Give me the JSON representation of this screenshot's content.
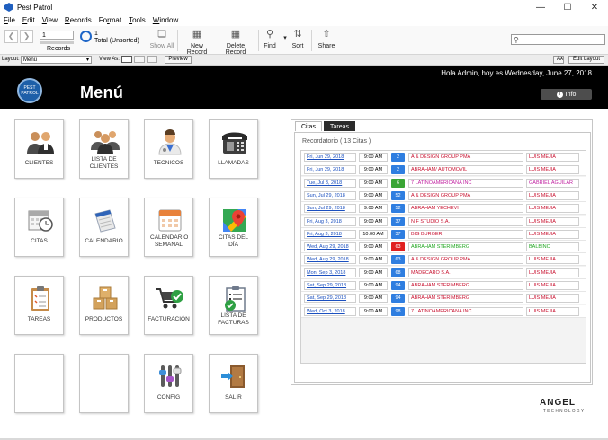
{
  "window": {
    "title": "Pest Patrol",
    "controls": [
      "—",
      "☐",
      "✕"
    ]
  },
  "menubar": [
    {
      "label": "File",
      "u": "F",
      "rest": "ile"
    },
    {
      "label": "Edit",
      "u": "E",
      "rest": "dit"
    },
    {
      "label": "View",
      "u": "V",
      "rest": "iew"
    },
    {
      "label": "Records",
      "u": "R",
      "rest": "ecords"
    },
    {
      "label": "Format",
      "pre": "Fo",
      "u": "r",
      "rest": "mat"
    },
    {
      "label": "Tools",
      "u": "T",
      "rest": "ools"
    },
    {
      "label": "Window",
      "u": "W",
      "rest": "indow"
    }
  ],
  "toolbar": {
    "record_value": "1",
    "records_label": "Records",
    "total_count": "1",
    "total_label": "Total (Unsorted)",
    "show_all": "Show All",
    "new_record": "New Record",
    "delete_record": "Delete Record",
    "find": "Find",
    "sort": "Sort",
    "share": "Share",
    "search_placeholder": ""
  },
  "layoutbar": {
    "layout_label": "Layout:",
    "layout_value": "Menú",
    "view_as_label": "View As:",
    "preview": "Preview",
    "aa": "Aᴀ",
    "edit_layout": "Edit Layout"
  },
  "header": {
    "logo_text": "PEST PATROL",
    "title": "Menú",
    "greeting": "Hola Admin, hoy es Wednesday, June 27, 2018",
    "info": "Info"
  },
  "tiles": [
    {
      "label": "CLIENTES",
      "icon": "clients-icon"
    },
    {
      "label": "LISTA DE CLIENTES",
      "icon": "client-list-icon"
    },
    {
      "label": "TECNICOS",
      "icon": "technician-icon"
    },
    {
      "label": "LLAMADAS",
      "icon": "phone-icon"
    },
    {
      "label": "CITAS",
      "icon": "calendar-clock-icon"
    },
    {
      "label": "CALENDARIO",
      "icon": "notepad-icon"
    },
    {
      "label": "CALENDARIO SEMANAL",
      "icon": "weekly-calendar-icon"
    },
    {
      "label": "CITAS DEL DÍA",
      "icon": "map-icon"
    },
    {
      "label": "TAREAS",
      "icon": "clipboard-icon"
    },
    {
      "label": "PRODUCTOS",
      "icon": "boxes-icon"
    },
    {
      "label": "FACTURACIÓN",
      "icon": "cart-check-icon"
    },
    {
      "label": "LISTA DE FACTURAS",
      "icon": "invoice-list-icon"
    },
    {
      "label": "",
      "icon": ""
    },
    {
      "label": "",
      "icon": ""
    },
    {
      "label": "CONFIG",
      "icon": "sliders-icon"
    },
    {
      "label": "SALIR",
      "icon": "exit-door-icon"
    }
  ],
  "tabs": [
    {
      "label": "Citas",
      "active": true
    },
    {
      "label": "Tareas",
      "active": false
    }
  ],
  "appointments_title": "Recordatorio  ( 13  Citas )",
  "appointments": [
    {
      "date": "Fri, Jun 29, 2018",
      "time": "9:00 AM",
      "num": "2",
      "badge_color": "#2f7ee0",
      "client": "A & DESIGN GROUP PMA",
      "client_color": "#c8102e",
      "person": "LUIS MEJIA",
      "person_color": "#c8102e"
    },
    {
      "date": "Fri, Jun 29, 2018",
      "time": "9:00 AM",
      "num": "2",
      "badge_color": "#2f7ee0",
      "client": "ABRAHAM/ AUTOMOVIL",
      "client_color": "#c8102e",
      "person": "LUIS MEJIA",
      "person_color": "#c8102e"
    },
    {
      "date": "Tue, Jul 3, 2018",
      "time": "9:00 AM",
      "num": "6",
      "badge_color": "#3aa535",
      "client": "7 LATINOAMERICANA  INC",
      "client_color": "#c020a0",
      "person": "GABRIEL AGUILAR",
      "person_color": "#c020a0"
    },
    {
      "date": "Sun, Jul 29, 2018",
      "time": "9:00 AM",
      "num": "52",
      "badge_color": "#2f7ee0",
      "client": "A & DESIGN GROUP PMA",
      "client_color": "#c8102e",
      "person": "LUIS MEJIA",
      "person_color": "#c8102e"
    },
    {
      "date": "Sun, Jul 29, 2018",
      "time": "9:00 AM",
      "num": "52",
      "badge_color": "#2f7ee0",
      "client": "ABRAHAM YECHEVI",
      "client_color": "#c8102e",
      "person": "LUIS MEJIA",
      "person_color": "#c8102e"
    },
    {
      "date": "Fri, Aug 3, 2018",
      "time": "9:00 AM",
      "num": "37",
      "badge_color": "#2f7ee0",
      "client": "N F STUDIO S.A.",
      "client_color": "#c8102e",
      "person": "LUIS MEJIA",
      "person_color": "#c8102e"
    },
    {
      "date": "Fri, Aug 3, 2018",
      "time": "10:00 AM",
      "num": "37",
      "badge_color": "#2f7ee0",
      "client": "BIG BURGER",
      "client_color": "#c8102e",
      "person": "LUIS MEJIA",
      "person_color": "#c8102e"
    },
    {
      "date": "Wed, Aug 29, 2018",
      "time": "9:00 AM",
      "num": "63",
      "badge_color": "#e02020",
      "client": "ABRAHAM STERIMBERG",
      "client_color": "#1ea51e",
      "person": "BALBINO",
      "person_color": "#1ea51e"
    },
    {
      "date": "Wed, Aug 29, 2018",
      "time": "9:00 AM",
      "num": "63",
      "badge_color": "#2f7ee0",
      "client": "A & DESIGN GROUP PMA",
      "client_color": "#c8102e",
      "person": "LUIS MEJIA",
      "person_color": "#c8102e"
    },
    {
      "date": "Mon, Sep 3, 2018",
      "time": "9:00 AM",
      "num": "68",
      "badge_color": "#2f7ee0",
      "client": "MADECARO S.A.",
      "client_color": "#c8102e",
      "person": "LUIS MEJIA",
      "person_color": "#c8102e"
    },
    {
      "date": "Sat, Sep 29, 2018",
      "time": "9:00 AM",
      "num": "94",
      "badge_color": "#2f7ee0",
      "client": "ABRAHAM STERIMBERG",
      "client_color": "#c8102e",
      "person": "LUIS MEJIA",
      "person_color": "#c8102e"
    },
    {
      "date": "Sat, Sep 29, 2018",
      "time": "9:00 AM",
      "num": "94",
      "badge_color": "#2f7ee0",
      "client": "ABRAHAM STERIMBERG",
      "client_color": "#c8102e",
      "person": "LUIS MEJIA",
      "person_color": "#c8102e"
    },
    {
      "date": "Wed, Oct 3, 2018",
      "time": "9:00 AM",
      "num": "98",
      "badge_color": "#2f7ee0",
      "client": "7 LATINOAMERICANA  INC",
      "client_color": "#c8102e",
      "person": "LUIS MEJIA",
      "person_color": "#c8102e"
    }
  ],
  "brand": {
    "name": "ANGEL",
    "sub": "TECHNOLOGY"
  }
}
